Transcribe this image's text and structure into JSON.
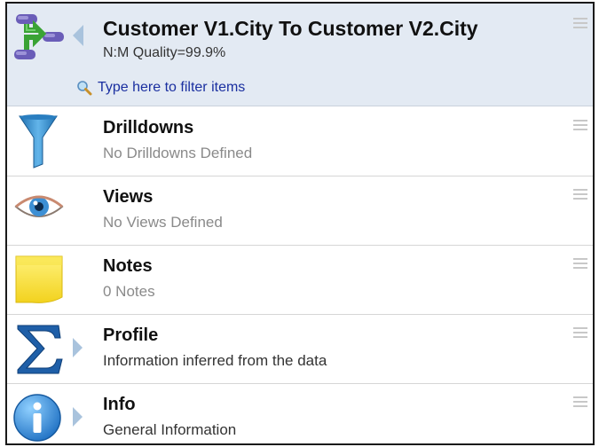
{
  "header": {
    "title": "Customer V1.City To Customer V2.City",
    "subtitle": "N:M  Quality=99.9%",
    "filter_placeholder": "Type here to filter items"
  },
  "rows": [
    {
      "title": "Drilldowns",
      "subtitle": "No Drilldowns Defined",
      "icon": "funnel-icon"
    },
    {
      "title": "Views",
      "subtitle": "No Views Defined",
      "icon": "eye-icon"
    },
    {
      "title": "Notes",
      "subtitle": "0 Notes",
      "icon": "sticky-note-icon"
    },
    {
      "title": "Profile",
      "subtitle": "Information inferred from the data",
      "icon": "sigma-icon"
    },
    {
      "title": "Info",
      "subtitle": "General Information",
      "icon": "info-icon"
    }
  ],
  "colors": {
    "header_bg": "#e3eaf3",
    "filter_link": "#1a2fa0",
    "arrow": "#a9c3dd"
  }
}
